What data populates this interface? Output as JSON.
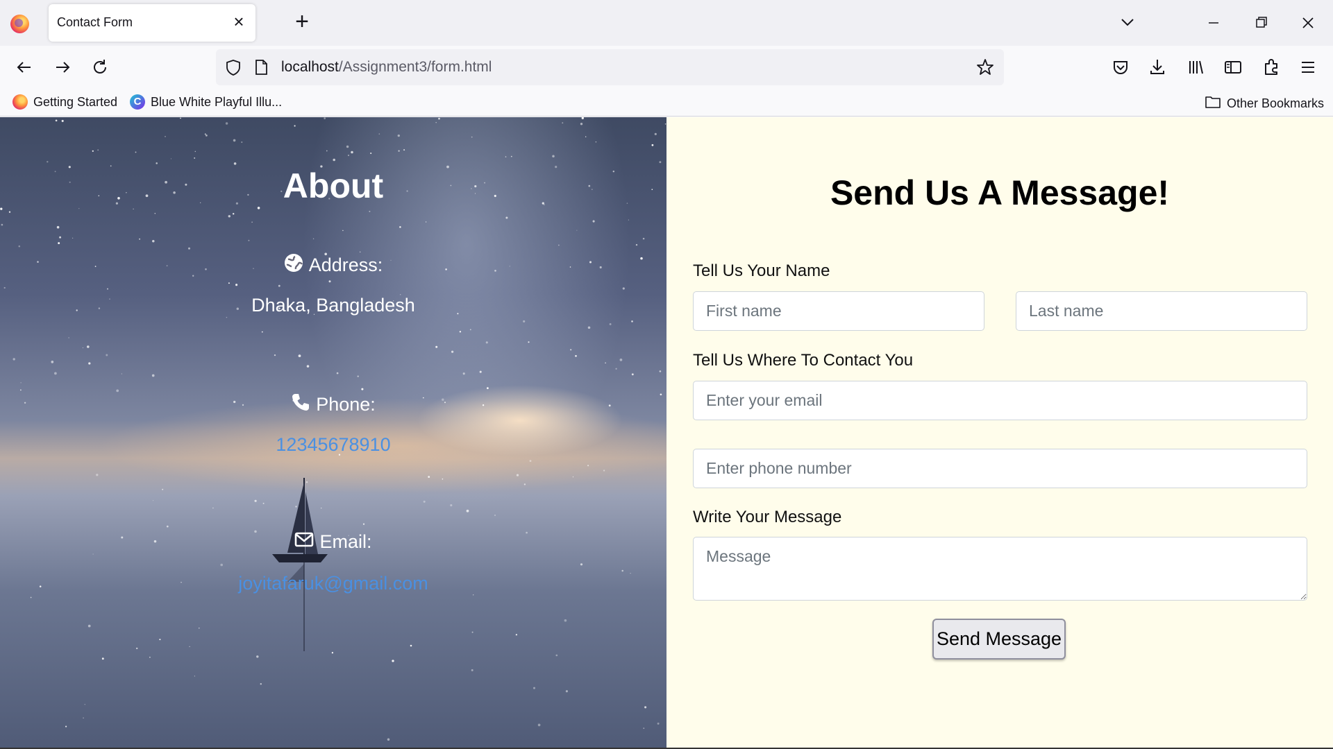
{
  "browser": {
    "tab_title": "Contact Form",
    "url_host": "localhost",
    "url_path": "/Assignment3/form.html",
    "bookmarks": [
      {
        "label": "Getting Started",
        "icon": "firefox-icon"
      },
      {
        "label": "Blue White Playful Illu...",
        "icon": "canva-icon"
      }
    ],
    "other_bookmarks": "Other Bookmarks"
  },
  "about": {
    "title": "About",
    "address_label": "Address:",
    "address_value": "Dhaka, Bangladesh",
    "phone_label": "Phone:",
    "phone_value": "12345678910",
    "email_label": "Email:",
    "email_value": "joyitafaruk@gmail.com"
  },
  "form": {
    "title": "Send Us A Message!",
    "name_label": "Tell Us Your Name",
    "first_name_placeholder": "First name",
    "last_name_placeholder": "Last name",
    "contact_label": "Tell Us Where To Contact You",
    "email_placeholder": "Enter your email",
    "phone_placeholder": "Enter phone number",
    "message_label": "Write Your Message",
    "message_placeholder": "Message",
    "submit_label": "Send Message"
  },
  "colors": {
    "form_background": "#fffdeb",
    "link": "#4a90e2",
    "chrome": "#f0f0f4"
  }
}
